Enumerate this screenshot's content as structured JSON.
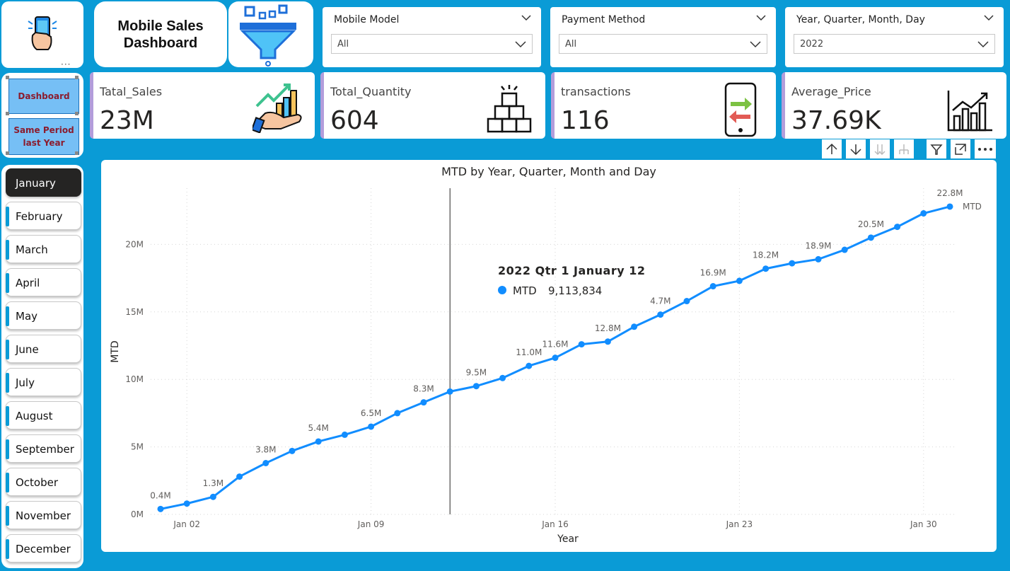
{
  "header": {
    "title_line1": "Mobile Sales",
    "title_line2": "Dashboard"
  },
  "icons": {
    "logo": "phone-in-hand-icon",
    "filter": "funnel-filter-icon",
    "sales": "growth-chart-hand-icon",
    "quantity": "stacked-boxes-icon",
    "transactions": "phone-transfer-arrows-icon",
    "average_price": "bar-chart-growth-icon"
  },
  "slicers": [
    {
      "title": "Mobile Model",
      "value": "All"
    },
    {
      "title": "Payment Method",
      "value": "All"
    },
    {
      "title": "Year, Quarter, Month, Day",
      "value": "2022"
    }
  ],
  "nav": {
    "dashboard": "Dashboard",
    "same_period_line1": "Same Period",
    "same_period_line2": "last Year"
  },
  "months": [
    "January",
    "February",
    "March",
    "April",
    "May",
    "June",
    "July",
    "August",
    "September",
    "October",
    "November",
    "December"
  ],
  "active_month": "January",
  "kpis": [
    {
      "label": "Tatal_Sales",
      "value": "23M"
    },
    {
      "label": "Total_Quantity",
      "value": "604"
    },
    {
      "label": "transactions",
      "value": "116"
    },
    {
      "label": "Average_Price",
      "value": "37.69K"
    }
  ],
  "colors": {
    "background": "#0a9bd6",
    "line": "#118dff",
    "active_month": "#252423",
    "nav_button": "#76bff5",
    "kpi_accent": "#b39ddb"
  },
  "chart_data": {
    "type": "line",
    "title": "MTD by Year, Quarter, Month and Day",
    "xlabel": "Year",
    "ylabel": "MTD",
    "x_ticks": [
      "Jan 02",
      "Jan 09",
      "Jan 16",
      "Jan 23",
      "Jan 30"
    ],
    "y_ticks": [
      "0M",
      "5M",
      "10M",
      "15M",
      "20M"
    ],
    "ylim": [
      0,
      25
    ],
    "y_unit": "M",
    "grid": true,
    "series": [
      {
        "name": "MTD",
        "x": [
          "Jan 01",
          "Jan 02",
          "Jan 03",
          "Jan 04",
          "Jan 05",
          "Jan 06",
          "Jan 07",
          "Jan 08",
          "Jan 09",
          "Jan 10",
          "Jan 11",
          "Jan 12",
          "Jan 13",
          "Jan 14",
          "Jan 15",
          "Jan 16",
          "Jan 17",
          "Jan 18",
          "Jan 19",
          "Jan 20",
          "Jan 21",
          "Jan 22",
          "Jan 23",
          "Jan 24",
          "Jan 25",
          "Jan 26",
          "Jan 27",
          "Jan 28",
          "Jan 29",
          "Jan 30",
          "Jan 31"
        ],
        "values": [
          0.4,
          0.8,
          1.3,
          2.8,
          3.8,
          4.7,
          5.4,
          5.9,
          6.5,
          7.5,
          8.3,
          9.1,
          9.5,
          10.1,
          11.0,
          11.6,
          12.6,
          12.8,
          13.9,
          14.8,
          15.8,
          16.9,
          17.3,
          18.2,
          18.6,
          18.9,
          19.6,
          20.5,
          21.3,
          22.3,
          22.8
        ],
        "data_labels": [
          {
            "x": "Jan 01",
            "label": "0.4M"
          },
          {
            "x": "Jan 03",
            "label": "1.3M"
          },
          {
            "x": "Jan 05",
            "label": "3.8M"
          },
          {
            "x": "Jan 07",
            "label": "5.4M"
          },
          {
            "x": "Jan 09",
            "label": "6.5M"
          },
          {
            "x": "Jan 11",
            "label": "8.3M"
          },
          {
            "x": "Jan 13",
            "label": "9.5M"
          },
          {
            "x": "Jan 15",
            "label": "11.0M"
          },
          {
            "x": "Jan 16",
            "label": "11.6M"
          },
          {
            "x": "Jan 18",
            "label": "12.8M"
          },
          {
            "x": "Jan 20",
            "label": "4.7M"
          },
          {
            "x": "Jan 22",
            "label": "16.9M"
          },
          {
            "x": "Jan 24",
            "label": "18.2M"
          },
          {
            "x": "Jan 26",
            "label": "18.9M"
          },
          {
            "x": "Jan 28",
            "label": "20.5M"
          },
          {
            "x": "Jan 31",
            "label": "22.8M"
          }
        ]
      }
    ],
    "tooltip": {
      "x": "Jan 12",
      "title": "2022 Qtr 1 January 12",
      "series": "MTD",
      "value": "9,113,834"
    }
  }
}
